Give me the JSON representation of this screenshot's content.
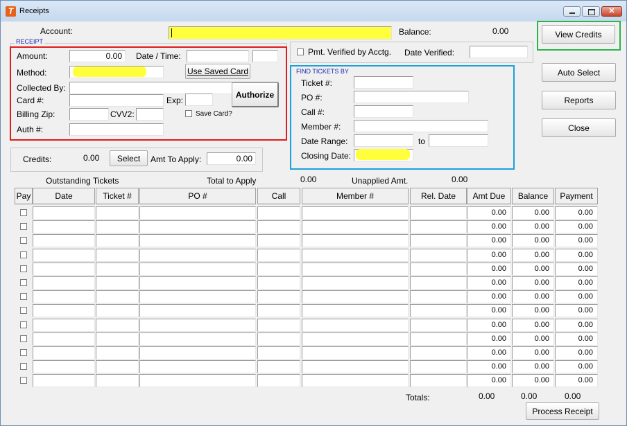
{
  "window": {
    "title": "Receipts"
  },
  "account": {
    "label": "Account:",
    "value": ""
  },
  "balance": {
    "label": "Balance:",
    "value": "0.00"
  },
  "receipt": {
    "group_title": "RECEIPT",
    "amount_label": "Amount:",
    "amount_value": "0.00",
    "datetime_label": "Date / Time:",
    "method_label": "Method:",
    "use_saved_card_label": "Use Saved Card",
    "collected_by_label": "Collected By:",
    "card_label": "Card #:",
    "exp_label": "Exp:",
    "authorize_label": "Authorize",
    "billing_zip_label": "Billing Zip:",
    "cvv2_label": "CVV2:",
    "save_card_label": "Save Card?",
    "auth_label": "Auth #:"
  },
  "verify": {
    "pmt_verified_label": "Pmt. Verified by Acctg.",
    "date_verified_label": "Date Verified:"
  },
  "find": {
    "group_title": "FIND TICKETS BY",
    "ticket_label": "Ticket #:",
    "po_label": "PO #:",
    "call_label": "Call #:",
    "member_label": "Member #:",
    "date_range_label": "Date Range:",
    "to_label": "to",
    "closing_date_label": "Closing Date:"
  },
  "credits": {
    "label": "Credits:",
    "value": "0.00",
    "select_label": "Select",
    "amt_to_apply_label": "Amt To Apply:",
    "amt_to_apply_value": "0.00"
  },
  "buttons": {
    "view_credits": "View Credits",
    "auto_select": "Auto Select",
    "reports": "Reports",
    "close": "Close",
    "process_receipt": "Process Receipt"
  },
  "summary": {
    "outstanding_tickets": "Outstanding Tickets",
    "total_to_apply_label": "Total to Apply",
    "total_to_apply_value": "0.00",
    "unapplied_label": "Unapplied Amt.",
    "unapplied_value": "0.00"
  },
  "table": {
    "columns": [
      "Pay",
      "Date",
      "Ticket #",
      "PO #",
      "Call",
      "Member #",
      "Rel. Date",
      "Amt Due",
      "Balance",
      "Payment"
    ],
    "rows": [
      {
        "amt_due": "0.00",
        "balance": "0.00",
        "payment": "0.00"
      },
      {
        "amt_due": "0.00",
        "balance": "0.00",
        "payment": "0.00"
      },
      {
        "amt_due": "0.00",
        "balance": "0.00",
        "payment": "0.00"
      },
      {
        "amt_due": "0.00",
        "balance": "0.00",
        "payment": "0.00"
      },
      {
        "amt_due": "0.00",
        "balance": "0.00",
        "payment": "0.00"
      },
      {
        "amt_due": "0.00",
        "balance": "0.00",
        "payment": "0.00"
      },
      {
        "amt_due": "0.00",
        "balance": "0.00",
        "payment": "0.00"
      },
      {
        "amt_due": "0.00",
        "balance": "0.00",
        "payment": "0.00"
      },
      {
        "amt_due": "0.00",
        "balance": "0.00",
        "payment": "0.00"
      },
      {
        "amt_due": "0.00",
        "balance": "0.00",
        "payment": "0.00"
      },
      {
        "amt_due": "0.00",
        "balance": "0.00",
        "payment": "0.00"
      },
      {
        "amt_due": "0.00",
        "balance": "0.00",
        "payment": "0.00"
      },
      {
        "amt_due": "0.00",
        "balance": "0.00",
        "payment": "0.00"
      }
    ]
  },
  "totals": {
    "label": "Totals:",
    "amt_due": "0.00",
    "balance": "0.00",
    "payment": "0.00"
  }
}
